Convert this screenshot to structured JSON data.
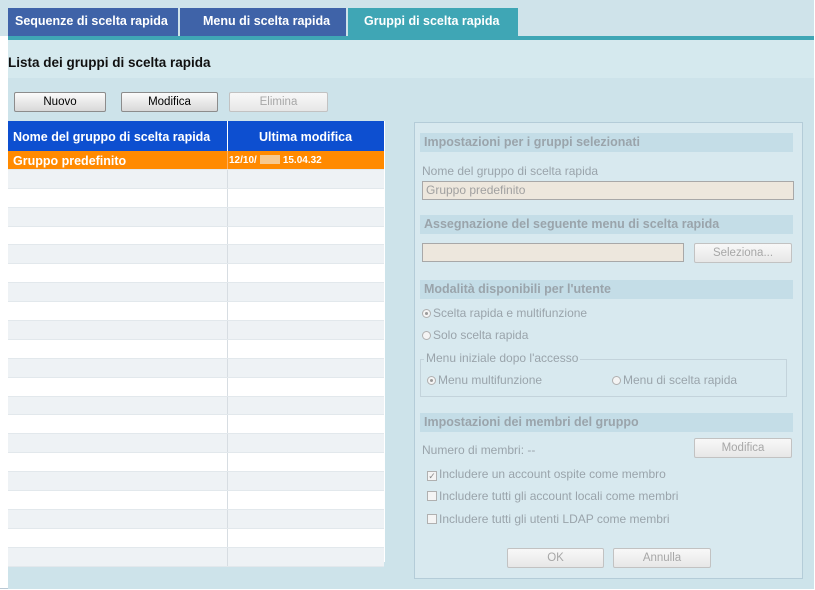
{
  "tabs": [
    {
      "label": "Sequenze di scelta rapida"
    },
    {
      "label": "Menu di scelta rapida"
    },
    {
      "label": "Gruppi di scelta rapida"
    }
  ],
  "page_title": "Lista dei gruppi di scelta rapida",
  "toolbar": {
    "new_label": "Nuovo",
    "edit_label": "Modifica",
    "delete_label": "Elimina"
  },
  "list": {
    "columns": [
      "Nome del gruppo di scelta rapida",
      "Ultima modifica"
    ],
    "rows": [
      {
        "name": "Gruppo predefinito",
        "date_prefix": "12/10/",
        "date_suffix": "15.04.32"
      }
    ]
  },
  "panel": {
    "header": "Impostazioni per i gruppi selezionati",
    "group_name_label": "Nome del gruppo di scelta rapida",
    "group_name_value": "Gruppo predefinito",
    "assign_header": "Assegnazione del seguente menu di scelta rapida",
    "assign_value": "",
    "select_button": "Seleziona...",
    "modes_header": "Modalità disponibili per l'utente",
    "mode_options": [
      "Scelta rapida e multifunzione",
      "Solo scelta rapida"
    ],
    "initial_menu_legend": "Menu iniziale dopo l'accesso",
    "initial_menu_options": [
      "Menu multifunzione",
      "Menu di scelta rapida"
    ],
    "members_header": "Impostazioni dei membri del gruppo",
    "members_count_label": "Numero di membri:",
    "members_count_value": "--",
    "members_edit_button": "Modifica",
    "checkboxes": [
      {
        "label": "Includere un account ospite come membro",
        "checked": true
      },
      {
        "label": "Includere tutti gli account locali come membri",
        "checked": false
      },
      {
        "label": "Includere tutti gli utenti LDAP come membri",
        "checked": false
      }
    ],
    "ok_button": "OK",
    "cancel_button": "Annulla"
  },
  "colors": {
    "tab_inactive": "#3f63a8",
    "tab_active": "#3fa6b5",
    "list_header": "#0d4fd0",
    "selection": "#ff8a00"
  }
}
